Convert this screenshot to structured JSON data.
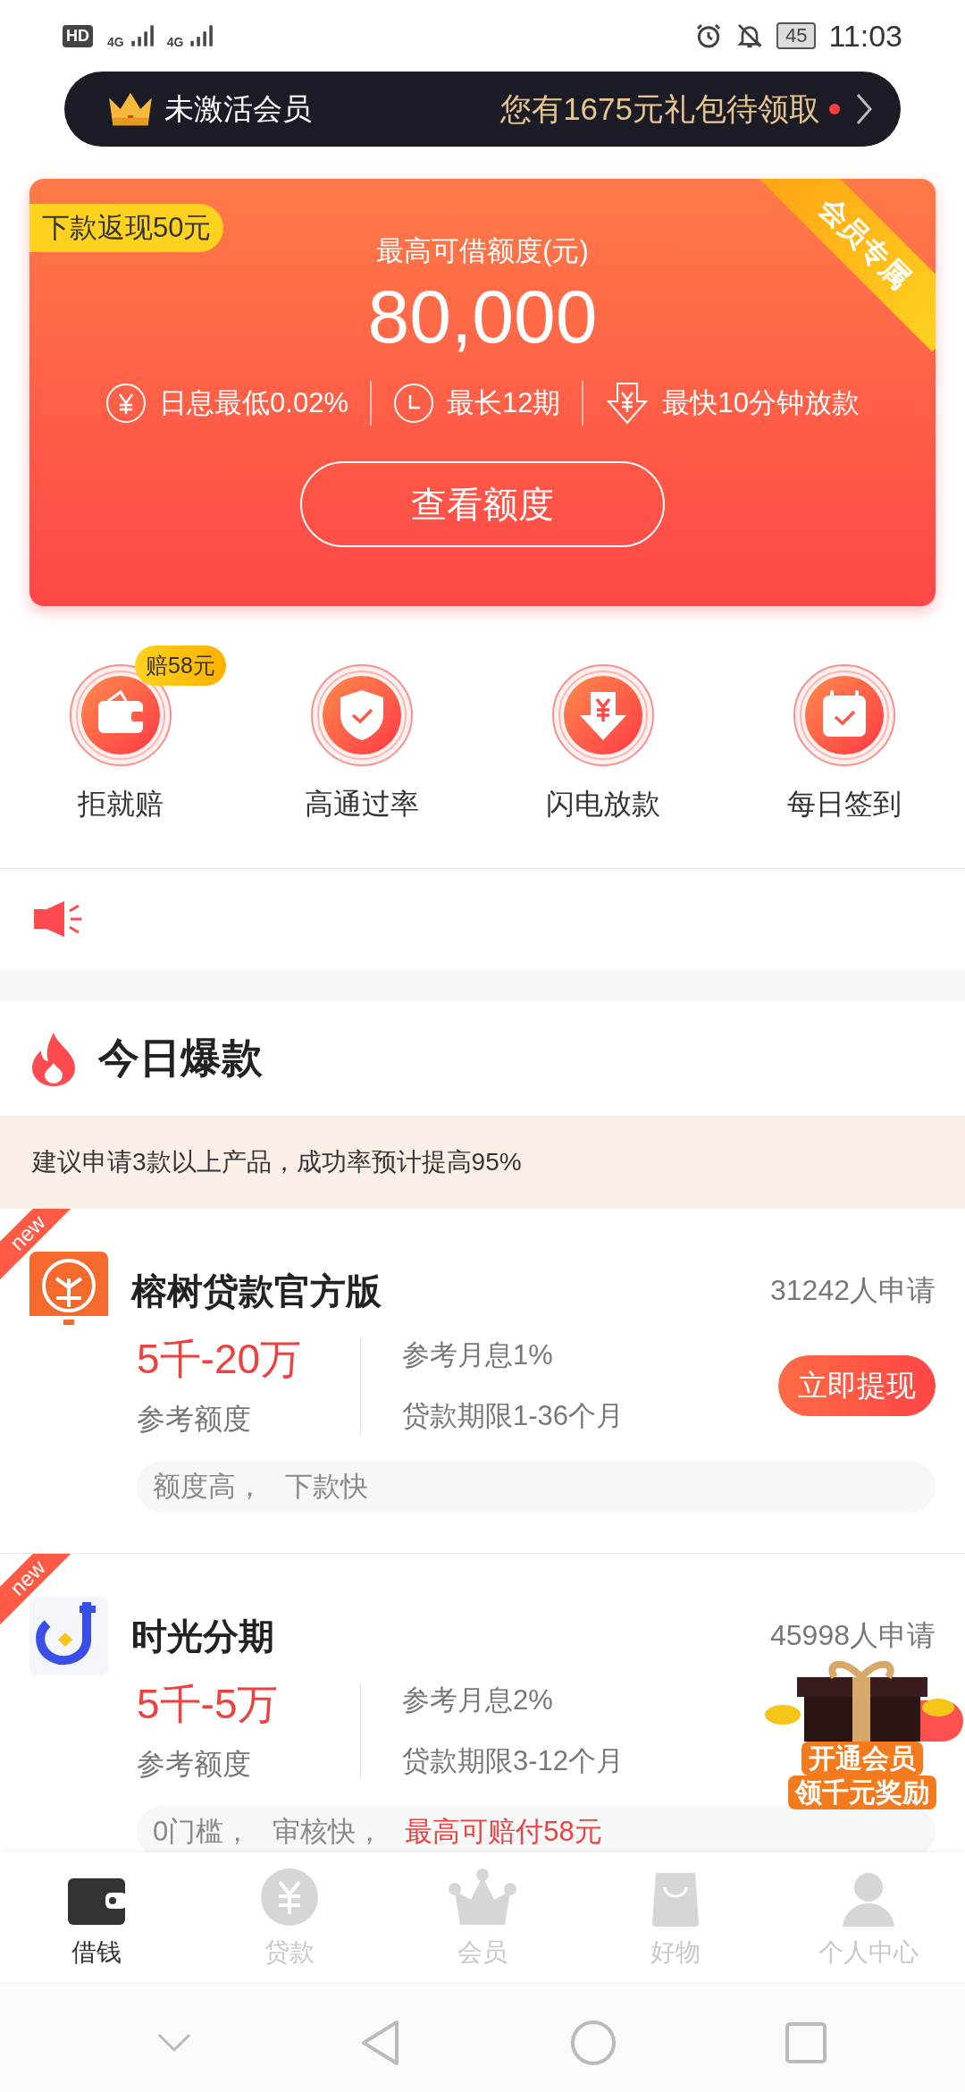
{
  "status_bar": {
    "network_labels": [
      "HD",
      "4G",
      "4G"
    ],
    "battery": "45",
    "time": "11:03"
  },
  "member_bar": {
    "status": "未激活会员",
    "offer": "您有1675元礼包待领取",
    "unread": true
  },
  "loan_card": {
    "badge": "下款返现50元",
    "ribbon": "会员专属",
    "label": "最高可借额度(元)",
    "amount": "80,000",
    "features": [
      {
        "kind": "yuan",
        "text": "日息最低0.02%"
      },
      {
        "kind": "clock",
        "text": "最长12期"
      },
      {
        "kind": "download",
        "text": "最快10分钟放款"
      }
    ],
    "button": "查看额度"
  },
  "quick_actions": [
    {
      "kind": "wallet",
      "label": "拒就赔",
      "badge": "赔58元"
    },
    {
      "kind": "shield",
      "label": "高通过率"
    },
    {
      "kind": "download",
      "label": "闪电放款"
    },
    {
      "kind": "calendar",
      "label": "每日签到"
    }
  ],
  "section": {
    "title": "今日爆款",
    "tip": "建议申请3款以上产品，成功率预计提高95%"
  },
  "products": [
    {
      "ribbon": "new",
      "kind": "tree",
      "name": "榕树贷款官方版",
      "applicants": "31242人申请",
      "amount": "5千-20万",
      "amount_label": "参考额度",
      "rate": "参考月息1%",
      "term": "贷款期限1-36个月",
      "button": "立即提现",
      "tags": [
        {
          "text": "额度高，",
          "highlight": false
        },
        {
          "text": "下款快",
          "highlight": false
        }
      ]
    },
    {
      "ribbon": "new",
      "kind": "hook",
      "name": "时光分期",
      "applicants": "45998人申请",
      "amount": "5千-5万",
      "amount_label": "参考额度",
      "rate": "参考月息2%",
      "term": "贷款期限3-12个月",
      "tags": [
        {
          "text": "0门槛，",
          "highlight": false
        },
        {
          "text": "审核快，",
          "highlight": false
        },
        {
          "text": "最高可赔付58元",
          "highlight": true
        }
      ]
    }
  ],
  "promo": {
    "line1": "开通会员",
    "line2": "领千元奖励"
  },
  "tab_bar": [
    {
      "kind": "wallet",
      "label": "借钱",
      "selected": true
    },
    {
      "kind": "yuan",
      "label": "贷款",
      "selected": false
    },
    {
      "kind": "crown",
      "label": "会员",
      "selected": false
    },
    {
      "kind": "bag",
      "label": "好物",
      "selected": false
    },
    {
      "kind": "person",
      "label": "个人中心",
      "selected": false
    }
  ]
}
